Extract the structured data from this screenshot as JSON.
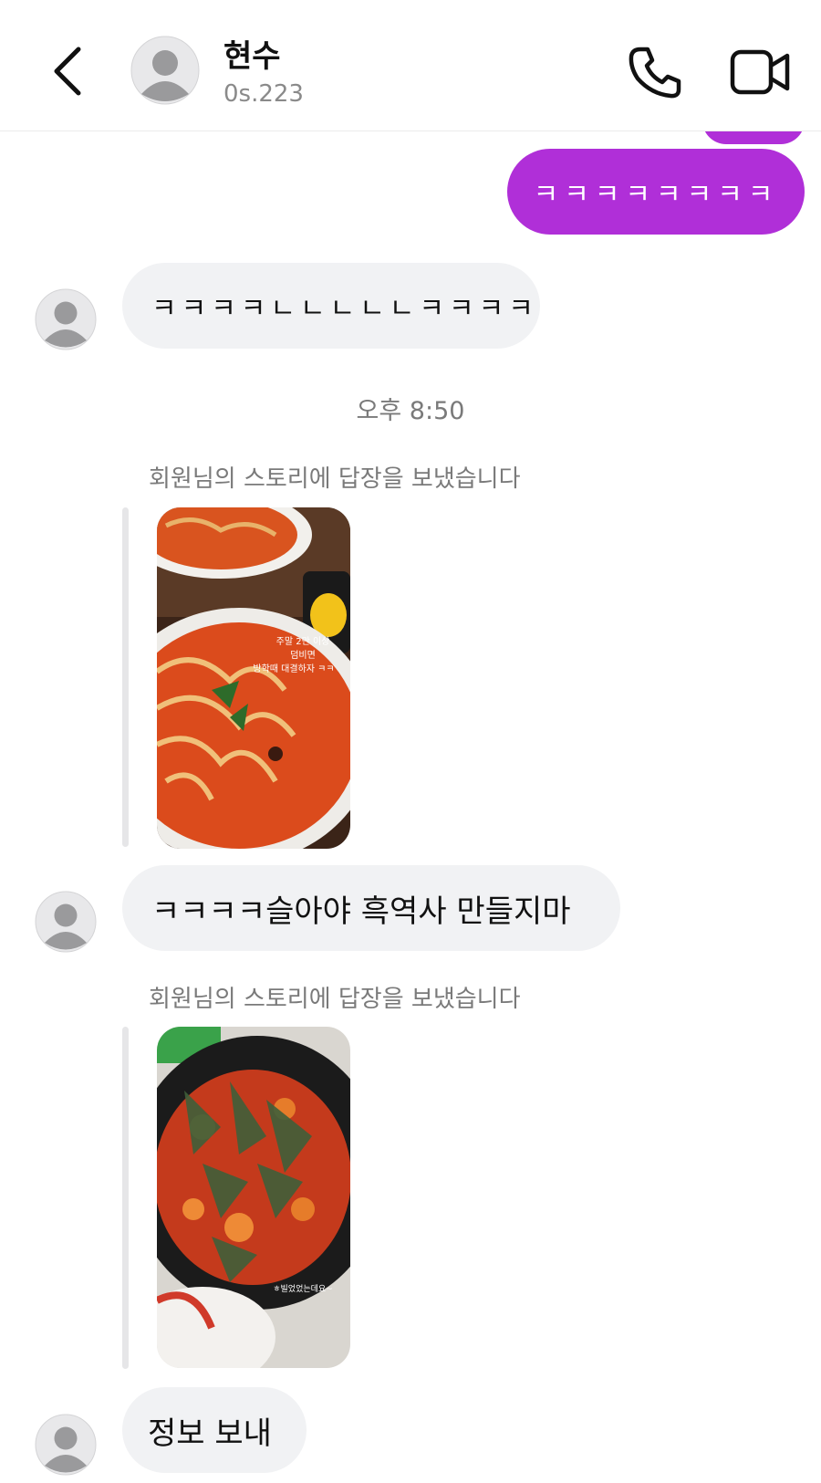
{
  "header": {
    "contact_name": "현수",
    "contact_handle": "0s.223"
  },
  "messages": {
    "sent_text": "ㅋㅋㅋㅋㅋㅋㅋㅋ",
    "received_1": "ㅋㅋㅋㅋㄴㄴㄴㄴㄴㅋㅋㅋㅋ",
    "timestamp": "오후 8:50",
    "story_reply_label_1": "회원님의 스토리에 답장을 보냈습니다",
    "story_1_caption": [
      "주말 2만 이상",
      "덤비면",
      "방학때 대결하자 ㅋㅋ"
    ],
    "received_2": "ㅋㅋㅋㅋ슬아야 흑역사 만들지마",
    "story_reply_label_2": "회원님의 스토리에 답장을 보냈습니다",
    "story_2_caption": "ㅎ빌었었는데요~",
    "received_3": "정보 보내"
  },
  "colors": {
    "sent_bubble": "#b02fd8",
    "received_bubble": "#f1f2f4",
    "meta_text": "#7a7a7a"
  }
}
